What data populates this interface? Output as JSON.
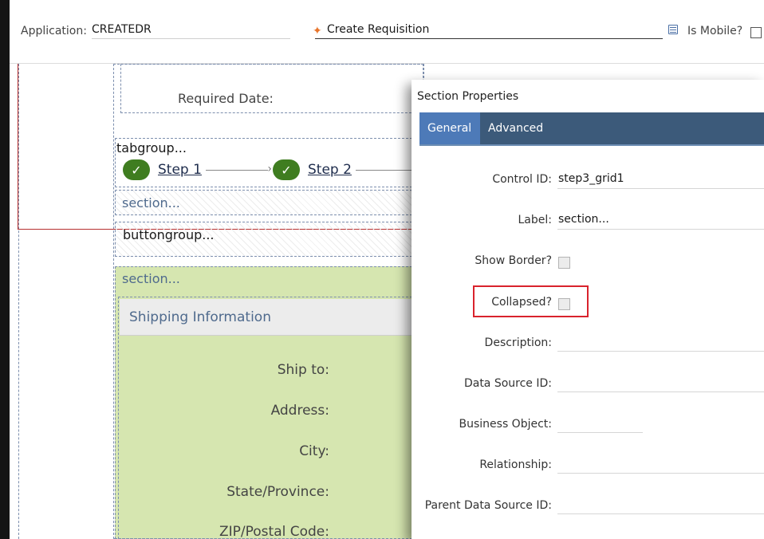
{
  "header": {
    "application_label": "Application:",
    "application_value": "CREATEDR",
    "title_value": "Create Requisition",
    "is_mobile_label": "Is Mobile?"
  },
  "canvas": {
    "required_date_label": "Required Date:",
    "tabgroup_label": "tabgroup...",
    "steps": [
      "Step 1",
      "Step 2"
    ],
    "section1_label": "section...",
    "buttongroup_label": "buttongroup...",
    "section2_label": "section...",
    "shipping_title": "Shipping Information",
    "shipping_fields": [
      "Ship to:",
      "Address:",
      "City:",
      "State/Province:",
      "ZIP/Postal Code:"
    ]
  },
  "dialog": {
    "title": "Section Properties",
    "tabs": {
      "general": "General",
      "advanced": "Advanced"
    },
    "props": {
      "control_id_label": "Control ID:",
      "control_id_value": "step3_grid1",
      "label_label": "Label:",
      "label_value": "section...",
      "show_border_label": "Show Border?",
      "collapsed_label": "Collapsed?",
      "description_label": "Description:",
      "data_source_label": "Data Source ID:",
      "business_object_label": "Business Object:",
      "relationship_label": "Relationship:",
      "parent_data_source_label": "Parent Data Source ID:"
    }
  },
  "colors": {
    "tab_bar": "#3c5a7a",
    "tab_active": "#4d7ab8",
    "step_check": "#3f7d20",
    "section_green": "#d6e6b0",
    "highlight": "#d9232d"
  }
}
